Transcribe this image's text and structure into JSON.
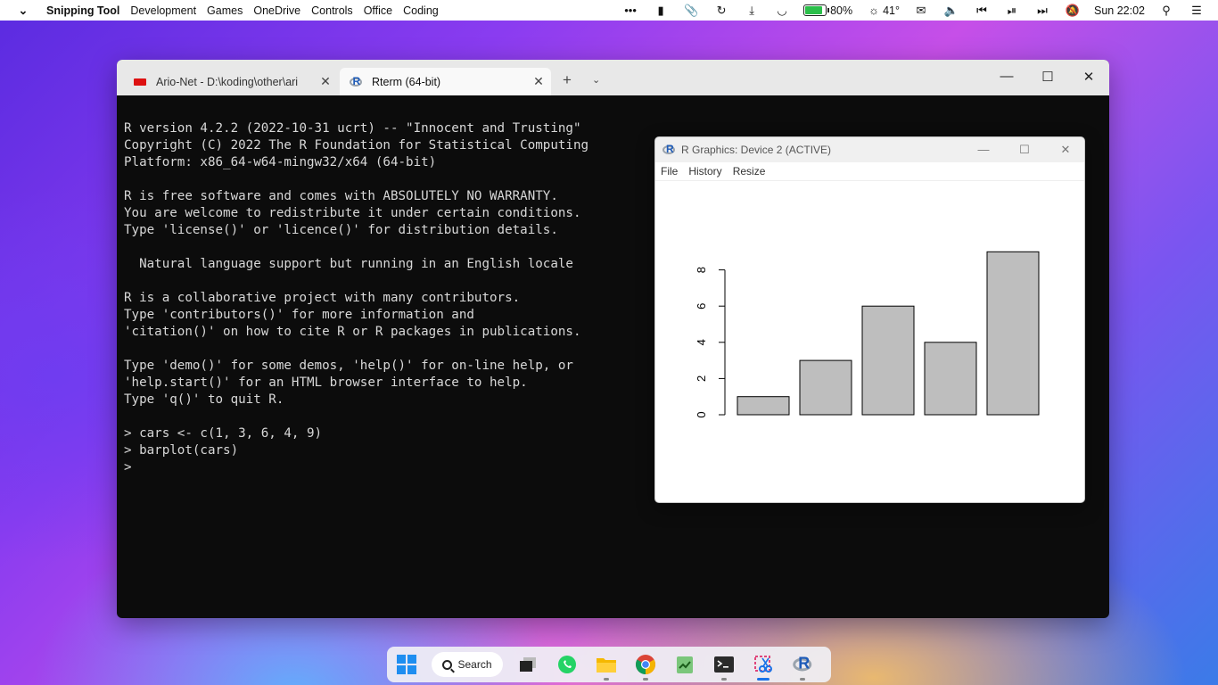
{
  "menubar": {
    "app": "Snipping Tool",
    "items": [
      "Development",
      "Games",
      "OneDrive",
      "Controls",
      "Office",
      "Coding"
    ],
    "battery": "80%",
    "brightness": "41°",
    "clock": "Sun 22:02"
  },
  "terminal": {
    "tabs": [
      {
        "label": "Ario-Net - D:\\koding\\other\\ari",
        "close": "✕"
      },
      {
        "label": "Rterm (64-bit)",
        "close": "✕"
      }
    ],
    "new_tab": "+",
    "lines": [
      "R version 4.2.2 (2022-10-31 ucrt) -- \"Innocent and Trusting\"",
      "Copyright (C) 2022 The R Foundation for Statistical Computing",
      "Platform: x86_64-w64-mingw32/x64 (64-bit)",
      "",
      "R is free software and comes with ABSOLUTELY NO WARRANTY.",
      "You are welcome to redistribute it under certain conditions.",
      "Type 'license()' or 'licence()' for distribution details.",
      "",
      "  Natural language support but running in an English locale",
      "",
      "R is a collaborative project with many contributors.",
      "Type 'contributors()' for more information and",
      "'citation()' on how to cite R or R packages in publications.",
      "",
      "Type 'demo()' for some demos, 'help()' for on-line help, or",
      "'help.start()' for an HTML browser interface to help.",
      "Type 'q()' to quit R.",
      "",
      "> cars <- c(1, 3, 6, 4, 9)",
      "> barplot(cars)",
      ">"
    ]
  },
  "graphics_window": {
    "title": "R Graphics: Device 2 (ACTIVE)",
    "menu": [
      "File",
      "History",
      "Resize"
    ]
  },
  "taskbar": {
    "search_label": "Search"
  },
  "chart_data": {
    "type": "bar",
    "categories": [
      "",
      "",
      "",
      "",
      ""
    ],
    "values": [
      1,
      3,
      6,
      4,
      9
    ],
    "title": "",
    "xlabel": "",
    "ylabel": "",
    "ylim": [
      0,
      9
    ],
    "yticks": [
      0,
      2,
      4,
      6,
      8
    ],
    "bar_color": "#bebebe",
    "grid": false
  }
}
